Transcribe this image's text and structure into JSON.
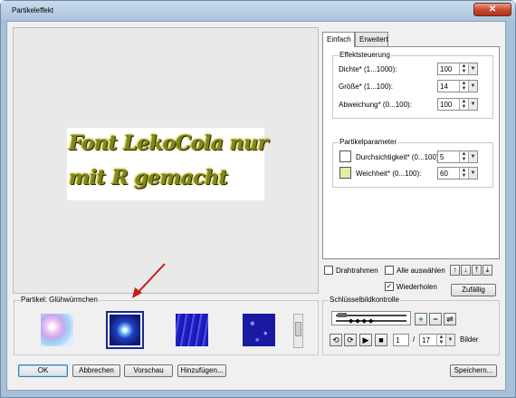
{
  "window": {
    "title": "Partikeleffekt",
    "close_glyph": "✕"
  },
  "preview": {
    "line1": "Font LekoCola nur",
    "line2": "mit R gemacht"
  },
  "tabs": [
    {
      "label": "Einfach"
    },
    {
      "label": "Erweitert"
    }
  ],
  "effektsteuerung": {
    "title": "Effektsteuerung",
    "rows": [
      {
        "label": "Dichte* (1...1000):",
        "value": "100"
      },
      {
        "label": "Größe* (1...100):",
        "value": "14"
      },
      {
        "label": "Abweichung* (0...100):",
        "value": "100"
      }
    ]
  },
  "partikelparameter": {
    "title": "Partikelparameter",
    "rows": [
      {
        "label": "Durchsichtigkeit* (0...100):",
        "value": "5",
        "swatch": "#ffffff"
      },
      {
        "label": "Weichheit* (0...100):",
        "value": "60",
        "swatch": "#dff2a0"
      }
    ]
  },
  "options": {
    "drahtrahmen": "Drahtrahmen",
    "alle_auswaehlen": "Alle auswählen",
    "wiederholen": "Wiederholen",
    "wiederholen_checked": "✓",
    "zufall": "Zufällig"
  },
  "particles": {
    "title": "Partikel: Glühwürmchen"
  },
  "keyframe": {
    "title": "Schlüsselbildkontrolle",
    "frame": "1",
    "sep": "/",
    "total": "17",
    "unit": "Bilder"
  },
  "buttons": {
    "ok": "OK",
    "abbrechen": "Abbrechen",
    "vorschau": "Vorschau",
    "hinzufuegen": "Hinzufügen...",
    "speichern": "Speichern..."
  },
  "colors": {
    "accent": "#3c7fb1",
    "window_frame": "#a7c1d9",
    "close": "#c8452a"
  }
}
